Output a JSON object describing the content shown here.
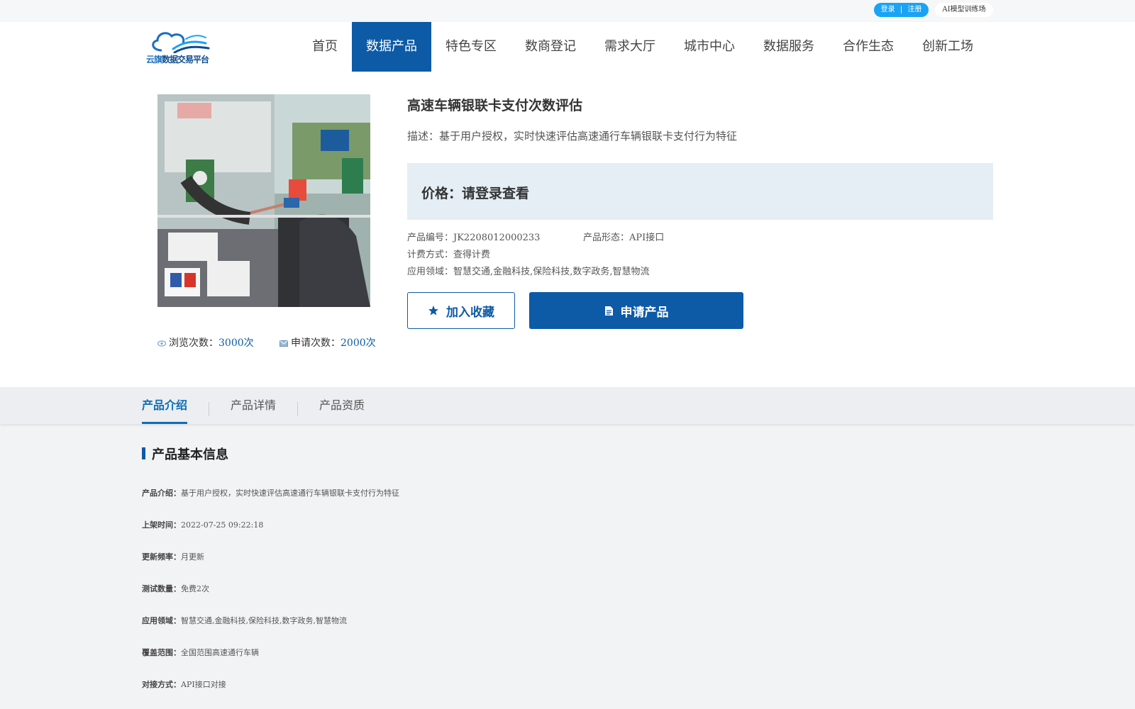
{
  "topbar": {
    "login": "登录",
    "separator": "|",
    "register": "注册",
    "ai_training": "AI模型训练场"
  },
  "brand": {
    "logo_text_1": "云旗",
    "logo_text_2": "数据交易平台",
    "colors": {
      "primary": "#0d5aa7",
      "accent": "#1aa3f4",
      "price_bg": "#e4eef4"
    }
  },
  "nav": {
    "items": [
      "首页",
      "数据产品",
      "特色专区",
      "数商登记",
      "需求大厅",
      "城市中心",
      "数据服务",
      "合作生态",
      "创新工场"
    ],
    "active_index": 1
  },
  "product": {
    "image_icon": "toll-booth-photo",
    "title": "高速车辆银联卡支付次数评估",
    "description": "描述：基于用户授权，实时快速评估高速通行车辆银联卡支付行为特征",
    "price": "价格：请登录查看",
    "code": "产品编号：JK2208012000233",
    "form": "产品形态：API接口",
    "billing": "计费方式：查得计费",
    "domain": "应用领域：智慧交通,金融科技,保险科技,数字政务,智慧物流",
    "favorite_label": "加入收藏",
    "apply_label": "申请产品",
    "views_label": "浏览次数：",
    "views_value": "3000次",
    "applies_label": "申请次数：",
    "applies_value": "2000次"
  },
  "tabs": {
    "items": [
      "产品介绍",
      "产品详情",
      "产品资质"
    ],
    "active_index": 0
  },
  "basic_info": {
    "title": "产品基本信息",
    "rows": [
      {
        "key": "产品介绍：",
        "value": "基于用户授权，实时快速评估高速通行车辆银联卡支付行为特征"
      },
      {
        "key": "上架时间：",
        "value": "2022-07-25 09:22:18"
      },
      {
        "key": "更新频率：",
        "value": "月更新"
      },
      {
        "key": "测试数量：",
        "value": "免费2次"
      },
      {
        "key": "应用领域：",
        "value": "智慧交通,金融科技,保险科技,数字政务,智慧物流"
      },
      {
        "key": "覆盖范围：",
        "value": "全国范围高速通行车辆"
      },
      {
        "key": "对接方式：",
        "value": "API接口对接"
      }
    ]
  }
}
